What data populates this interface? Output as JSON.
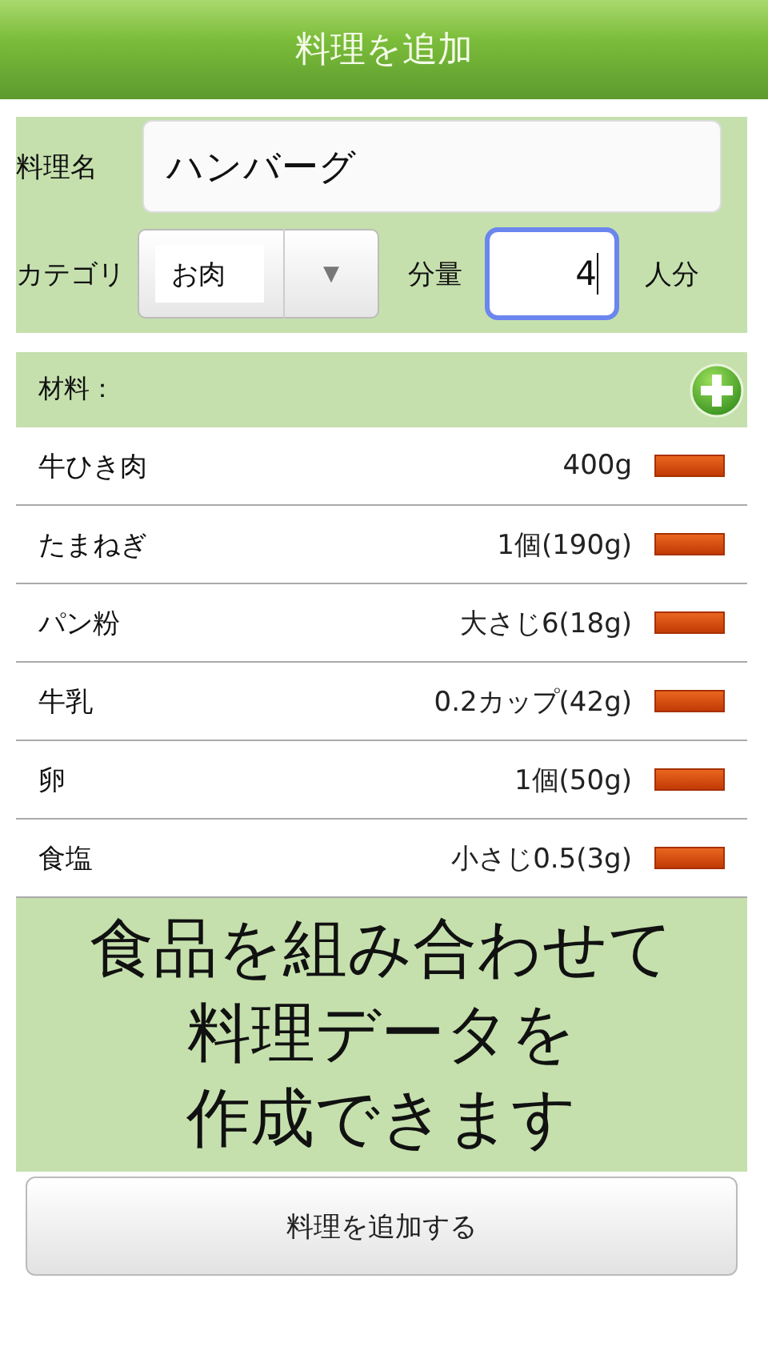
{
  "header": {
    "title": "料理を追加"
  },
  "form": {
    "name_label": "料理名",
    "name_value": "ハンバーグ",
    "category_label": "カテゴリ",
    "category_value": "お肉",
    "dropdown_icon": "▼",
    "amount_label": "分量",
    "amount_value": "4",
    "amount_unit": "人分"
  },
  "ingredients": {
    "title": "材料：",
    "rows": [
      {
        "name": "牛ひき肉",
        "amount": "400g"
      },
      {
        "name": "たまねぎ",
        "amount": "1個(190g)"
      },
      {
        "name": "パン粉",
        "amount": "大さじ6(18g)"
      },
      {
        "name": "牛乳",
        "amount": "0.2カップ(42g)"
      },
      {
        "name": "卵",
        "amount": "1個(50g)"
      },
      {
        "name": "食塩",
        "amount": "小さじ0.5(3g)"
      }
    ]
  },
  "promo": {
    "lines": [
      "食品を組み合わせて",
      "料理データを",
      "作成できます"
    ]
  },
  "buttons": [
    {
      "label": "料理を追加する"
    }
  ]
}
